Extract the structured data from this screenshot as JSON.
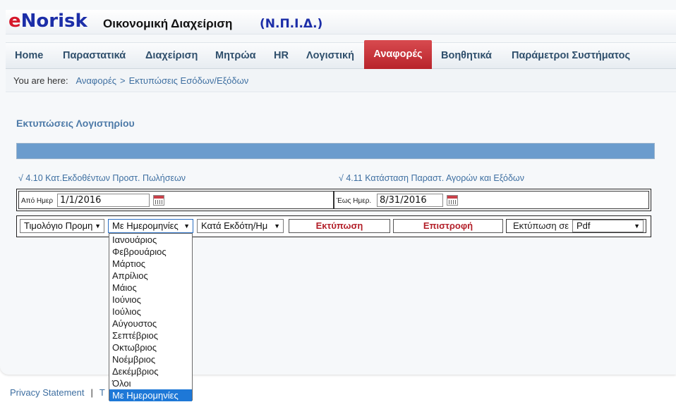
{
  "header": {
    "logo_e": "e",
    "logo_rest": "Norisk",
    "subtitle": "Οικονομική Διαχείριση",
    "org": "(Ν.Π.Ι.Δ.)"
  },
  "nav": {
    "items": [
      {
        "label": "Home"
      },
      {
        "label": "Παραστατικά"
      },
      {
        "label": "Διαχείριση"
      },
      {
        "label": "Μητρώα"
      },
      {
        "label": "HR"
      },
      {
        "label": "Λογιστική"
      },
      {
        "label": "Αναφορές",
        "active": true
      },
      {
        "label": "Βοηθητικά"
      },
      {
        "label": "Παράμετροι Συστήματος"
      }
    ]
  },
  "breadcrumb": {
    "prefix": "You are here:",
    "items": [
      "Αναφορές",
      ">",
      "Εκτυπώσεις Εσόδων/Εξόδων"
    ]
  },
  "page": {
    "title": "Εκτυπώσεις Λογιστηρίου",
    "links": [
      "√ 4.10 Κατ.Εκδοθέντων Προστ. Πωλήσεων",
      "√ 4.11 Κατάσταση Παραστ. Αγορών και Εξόδων"
    ]
  },
  "dates": {
    "from_label": "Από Ημερ",
    "from_value": "1/1/2016",
    "to_label": "Έως Ημερ.",
    "to_value": "8/31/2016"
  },
  "controls": {
    "doc_type": "Τιμολόγιο Προμη",
    "period": "Με Ημερομηνίες",
    "sort": "Κατά Εκδότη/Ημ",
    "print_button": "Εκτύπωση",
    "back_button": "Επιστροφή",
    "print_as_label": "Εκτύπωση σε",
    "format": "Pdf",
    "arrow": "▼"
  },
  "dropdown": {
    "options": [
      "Ιανουάριος",
      "Φεβρουάριος",
      "Μάρτιος",
      "Απρίλιος",
      "Μάιος",
      "Ιούνιος",
      "Ιούλιος",
      "Αύγουστος",
      "Σεπτέβριος",
      "Οκτωβριος",
      "Νοέμβριος",
      "Δεκέμβριος",
      "Όλοι",
      "Με Ημερομηνίες"
    ],
    "selected_index": 13
  },
  "footer": {
    "privacy": "Privacy Statement",
    "pipe": "|",
    "terms_fragment": "T"
  }
}
